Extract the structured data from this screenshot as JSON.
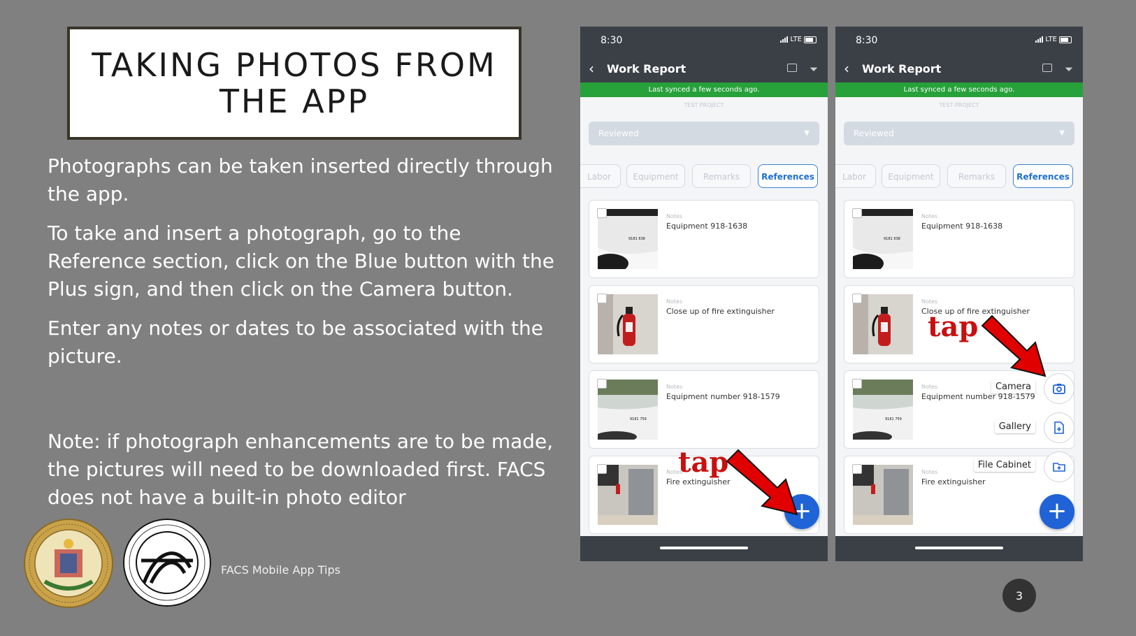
{
  "slide": {
    "title_line1": "TAKING PHOTOS FROM",
    "title_line2": "THE APP",
    "paragraphs": [
      "Photographs can be taken inserted directly through the app.",
      "To take and insert a photograph, go to the Reference section, click on the Blue button with the Plus sign, and then click on the Camera button.",
      "Enter any notes or dates to be associated with the picture."
    ],
    "note": "Note: if photograph enhancements are to be made, the pictures will need to be downloaded first. FACS does not have a built-in photo editor",
    "footer": "FACS Mobile App Tips",
    "page_number": "3"
  },
  "phone": {
    "time": "8:30",
    "network": "LTE",
    "back_glyph": "‹",
    "title": "Work Report",
    "sync_message": "Last synced a few seconds ago.",
    "project": "TEST PROJECT",
    "status_select": "Reviewed",
    "tabs": [
      "Labor",
      "Equipment",
      "Remarks",
      "References"
    ],
    "active_tab": "References",
    "notes_label": "Notes",
    "items": [
      {
        "note": "Equipment 918-1638"
      },
      {
        "note": "Close up of fire extinguisher"
      },
      {
        "note": "Equipment number 918-1579"
      },
      {
        "note": "Fire extinguisher"
      }
    ],
    "fab_glyph": "+",
    "plate_text_1": "9181 638",
    "plate_text_2": "9181 759"
  },
  "annotations": {
    "tap_label": "tap",
    "arrow_color": "#e00000"
  },
  "fab_menu": {
    "camera": "Camera",
    "gallery": "Gallery",
    "file_cabinet": "File Cabinet"
  }
}
